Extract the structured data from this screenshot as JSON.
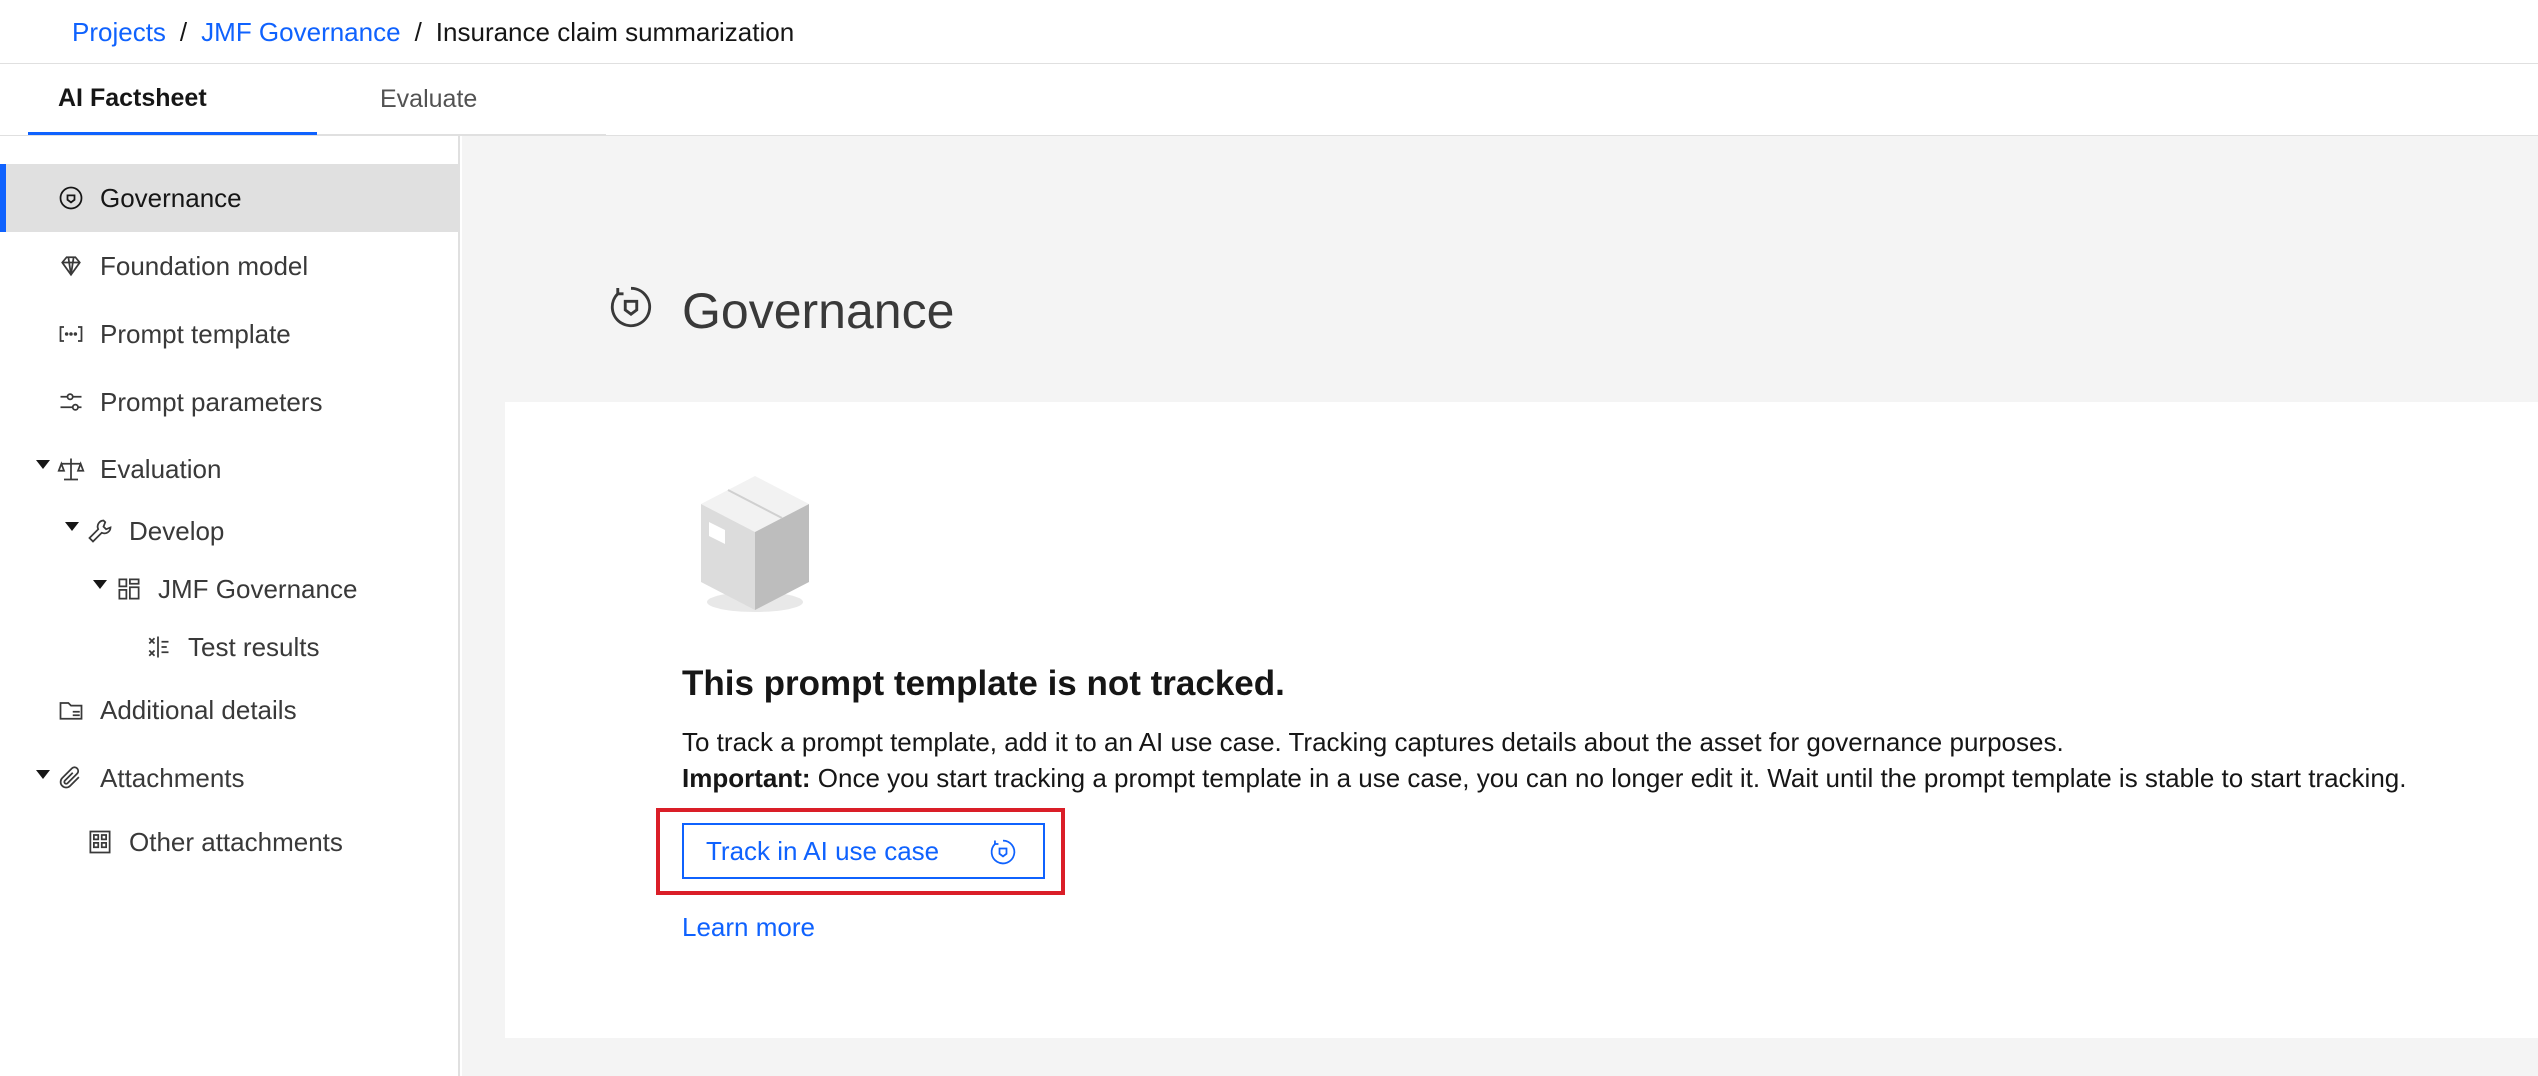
{
  "breadcrumb": {
    "items": [
      "Projects",
      "JMF Governance"
    ],
    "separator": "/",
    "current": "Insurance claim summarization"
  },
  "tabs": [
    {
      "label": "AI Factsheet",
      "active": true
    },
    {
      "label": "Evaluate",
      "active": false
    }
  ],
  "sidebar": {
    "items": [
      {
        "label": "Governance",
        "icon": "governance-icon"
      },
      {
        "label": "Foundation model",
        "icon": "diamond-icon"
      },
      {
        "label": "Prompt template",
        "icon": "bracket-dots-icon"
      },
      {
        "label": "Prompt parameters",
        "icon": "sliders-icon"
      },
      {
        "label": "Evaluation",
        "icon": "scale-icon"
      },
      {
        "label": "Develop",
        "icon": "wrench-icon"
      },
      {
        "label": "JMF Governance",
        "icon": "dashboard-icon"
      },
      {
        "label": "Test results",
        "icon": "test-results-icon"
      },
      {
        "label": "Additional details",
        "icon": "folder-details-icon"
      },
      {
        "label": "Attachments",
        "icon": "paperclip-icon"
      },
      {
        "label": "Other attachments",
        "icon": "grid-attachment-icon"
      }
    ]
  },
  "main": {
    "title": "Governance",
    "empty_state": {
      "title": "This prompt template is not tracked.",
      "description": "To track a prompt template, add it to an AI use case. Tracking captures details about the asset for governance purposes.",
      "important_label": "Important:",
      "important_text": " Once you start tracking a prompt template in a use case, you can no longer edit it. Wait until the prompt template is stable to start tracking.",
      "button_label": "Track in AI use case",
      "learn_more": "Learn more"
    }
  },
  "colors": {
    "accent": "#0f62fe",
    "highlight": "#da1e28",
    "selected_bg": "#e0e0e0",
    "main_bg": "#f4f4f4"
  }
}
